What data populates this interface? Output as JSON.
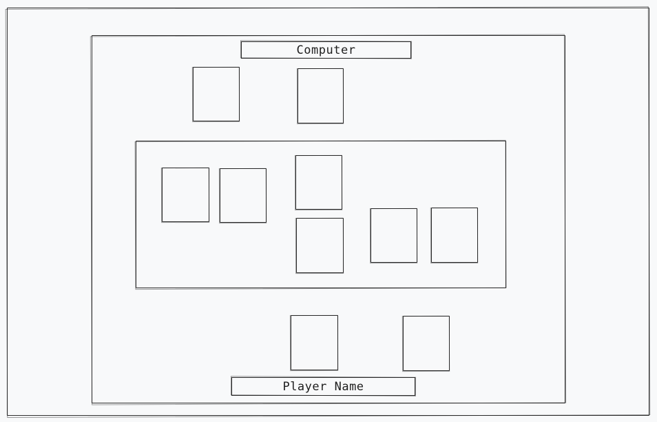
{
  "table": {
    "opponent_label": "Computer",
    "player_label": "Player Name"
  },
  "style": {
    "stroke_color": "#2e2e2e",
    "background_color": "#f8f9fa"
  }
}
